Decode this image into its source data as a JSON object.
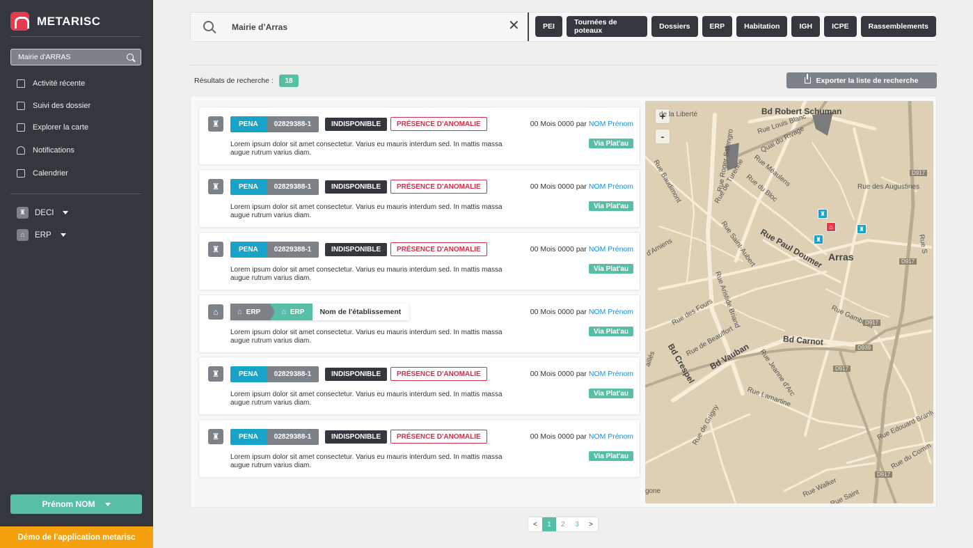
{
  "sidebar": {
    "brand": "METARISC",
    "search_value": "Mairie d'ARRAS",
    "nav": [
      {
        "label": "Activité récente",
        "icon": "house-icon"
      },
      {
        "label": "Suivi des dossier",
        "icon": "folder-icon"
      },
      {
        "label": "Explorer la carte",
        "icon": "map-icon"
      },
      {
        "label": "Notifications",
        "icon": "bell-icon"
      },
      {
        "label": "Calendrier",
        "icon": "calendar-icon"
      }
    ],
    "sections": [
      {
        "label": "DECI",
        "icon": "hydrant-icon"
      },
      {
        "label": "ERP",
        "icon": "building-icon"
      }
    ],
    "user_label": "Prénom NOM",
    "demo_label": "Démo de l'application metarisc"
  },
  "search": {
    "query": "Mairie d’Arras",
    "filters": [
      "PEI",
      "Tournées de poteaux",
      "Dossiers",
      "ERP",
      "Habitation",
      "IGH",
      "ICPE",
      "Rassemblements"
    ]
  },
  "results": {
    "label": "Résultats de recherche :",
    "count": "18",
    "export_label": "Exporter la liste de recherche",
    "items": [
      {
        "type": "pei",
        "tag_a": "PENA",
        "tag_b": "02829388-1",
        "status": "INDISPONIBLE",
        "anomaly": "PRÉSENCE D'ANOMALIE",
        "date_prefix": "00 Mois 0000 par",
        "author": "NOM Prénom",
        "via": "Via Plat'au",
        "desc": "Lorem ipsum dolor sit amet consectetur. Varius eu mauris interdum sed. In mattis massa augue rutrum varius diam."
      },
      {
        "type": "pei",
        "tag_a": "PENA",
        "tag_b": "02829388-1",
        "status": "INDISPONIBLE",
        "anomaly": "PRÉSENCE D'ANOMALIE",
        "date_prefix": "00 Mois 0000 par",
        "author": "NOM Prénom",
        "via": "Via Plat'au",
        "desc": "Lorem ipsum dolor sit amet consectetur. Varius eu mauris interdum sed. In mattis massa augue rutrum varius diam."
      },
      {
        "type": "pei",
        "tag_a": "PENA",
        "tag_b": "02829388-1",
        "status": "INDISPONIBLE",
        "anomaly": "PRÉSENCE D'ANOMALIE",
        "date_prefix": "00 Mois 0000 par",
        "author": "NOM Prénom",
        "via": "Via Plat'au",
        "desc": "Lorem ipsum dolor sit amet consectetur. Varius eu mauris interdum sed. In mattis massa augue rutrum varius diam."
      },
      {
        "type": "erp",
        "tag_a": "ERP",
        "tag_b": "ERP",
        "name": "Nom de l'établissement",
        "date_prefix": "00 Mois 0000 par",
        "author": "NOM Prénom",
        "via": "Via Plat'au",
        "desc": "Lorem ipsum dolor sit amet consectetur. Varius eu mauris interdum sed. In mattis massa augue rutrum varius diam."
      },
      {
        "type": "pei",
        "tag_a": "PENA",
        "tag_b": "02829388-1",
        "status": "INDISPONIBLE",
        "anomaly": "PRÉSENCE D'ANOMALIE",
        "date_prefix": "00 Mois 0000 par",
        "author": "NOM Prénom",
        "via": "Via Plat'au",
        "desc": "Lorem ipsum dolor sit amet consectetur. Varius eu mauris interdum sed. In mattis massa augue rutrum varius diam."
      },
      {
        "type": "pei",
        "tag_a": "PENA",
        "tag_b": "02829388-1",
        "status": "INDISPONIBLE",
        "anomaly": "PRÉSENCE D'ANOMALIE",
        "date_prefix": "00 Mois 0000 par",
        "author": "NOM Prénom",
        "via": "Via Plat'au",
        "desc": "Lorem ipsum dolor sit amet consectetur. Varius eu mauris interdum sed. In mattis massa augue rutrum varius diam."
      }
    ]
  },
  "map": {
    "zoom_in": "+",
    "zoom_out": "-",
    "labels": [
      "Bd Robert Schuman",
      "Rue Louis Blanc",
      "Quai du Rivage",
      "Rue Baudimont",
      "Rue Roger Salengro",
      "Rue de Turenne",
      "Rue Méaulens",
      "Rue du Bloc",
      "Rue des Augustines",
      "Rue Saint-Aubert",
      "Rue Paul Doumer",
      "Arras",
      "d'Amiens",
      "Rue Aristide Briand",
      "Rue des Fours",
      "Rue de Beauffort",
      "Bd Crespel",
      "Bd Vauban",
      "Bd Carnot",
      "Rue Gambetta",
      "Rue Jeanne d'Arc",
      "Rue Lamartine",
      "Rue de Grigny",
      "Rue Edouard Branly",
      "Rue du Comm",
      "Rue Walker",
      "Rue Saint",
      "de la Liberté",
      "Rue S",
      "gone",
      "aillés"
    ],
    "road_tags": [
      "D917",
      "D917",
      "D917",
      "D917",
      "D939",
      "D917"
    ]
  },
  "pagination": {
    "prev": "<",
    "pages": [
      "1",
      "2",
      "3"
    ],
    "next": ">",
    "current": "1"
  },
  "colors": {
    "sidebar": "#34383e",
    "accent": "#56bfa6",
    "blue": "#1aa3c8",
    "danger": "#d2304a",
    "demo": "#f5a10d"
  }
}
